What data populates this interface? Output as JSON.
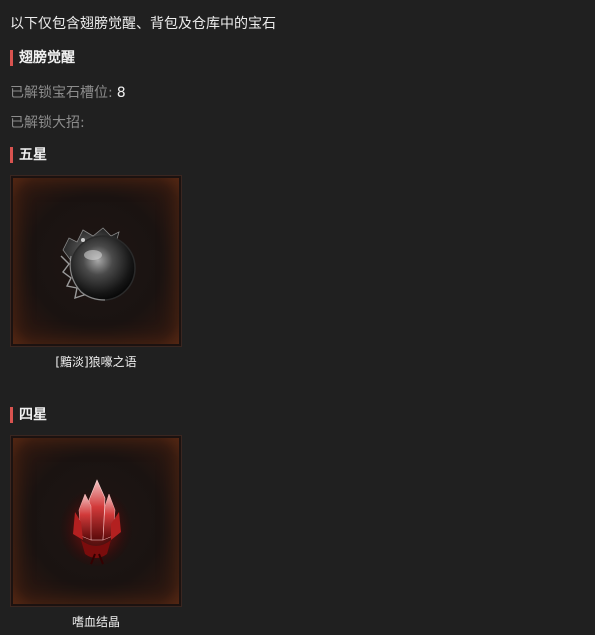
{
  "intro": "以下仅包含翅膀觉醒、背包及仓库中的宝石",
  "wing_awakening": {
    "title": "翅膀觉醒",
    "slots_label": "已解锁宝石槽位:",
    "slots_value": "8",
    "ultimate_label": "已解锁大招:"
  },
  "five_star": {
    "title": "五星",
    "gems": [
      {
        "name": "[黯淡]狼嚎之语",
        "icon": "wolf-orb-icon"
      }
    ]
  },
  "four_star": {
    "title": "四星",
    "gems": [
      {
        "name": "嗜血结晶",
        "icon": "blood-crystal-icon"
      }
    ]
  },
  "colors": {
    "accent_bar": "#d9534f",
    "background": "#202020",
    "frame_glow": "#5a2a14"
  }
}
